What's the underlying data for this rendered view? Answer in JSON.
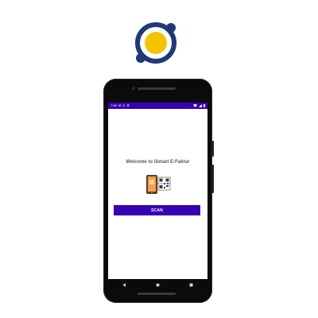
{
  "logo": {
    "icon": "orbit-logo-icon",
    "ring_color": "#1e3a78",
    "core_color": "#f5c400"
  },
  "status_bar": {
    "time": "7:58",
    "left_icons": [
      "M",
      "G",
      "⚙"
    ],
    "right_icons": [
      "wifi-icon",
      "signal-icon",
      "battery-icon"
    ],
    "color": "#3700b3"
  },
  "screen": {
    "welcome": "Welcome to iSmart E-Faktur",
    "illustration_icon": "phone-qr-scan-icon",
    "scan_label": "SCAN",
    "accent_color": "#3700b3"
  },
  "nav_bar": {
    "buttons": [
      "back-icon",
      "home-icon",
      "recents-icon"
    ]
  }
}
